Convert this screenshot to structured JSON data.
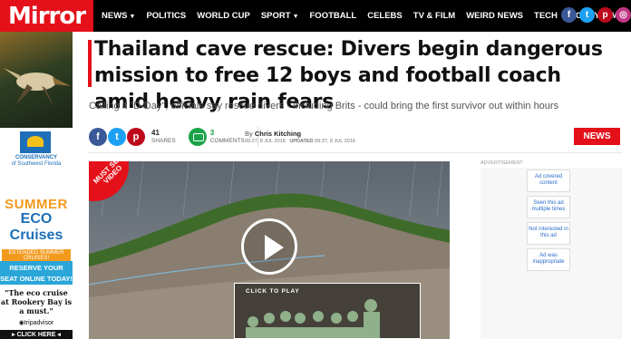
{
  "brand": {
    "name": "Mirror",
    "accent": "#e4101a"
  },
  "nav": {
    "items": [
      {
        "label": "NEWS",
        "dropdown": true
      },
      {
        "label": "POLITICS",
        "dropdown": false
      },
      {
        "label": "WORLD CUP",
        "dropdown": false
      },
      {
        "label": "SPORT",
        "dropdown": true
      },
      {
        "label": "FOOTBALL",
        "dropdown": false
      },
      {
        "label": "CELEBS",
        "dropdown": false
      },
      {
        "label": "TV & FILM",
        "dropdown": false
      },
      {
        "label": "WEIRD NEWS",
        "dropdown": false
      },
      {
        "label": "TECH",
        "dropdown": false
      },
      {
        "label": "MONEY",
        "dropdown": false
      },
      {
        "label": "MORE",
        "dropdown": true
      }
    ],
    "social": [
      {
        "icon": "facebook-icon",
        "glyph": "f",
        "color": "#3b5998"
      },
      {
        "icon": "twitter-icon",
        "glyph": "t",
        "color": "#1da1f2"
      },
      {
        "icon": "pinterest-icon",
        "glyph": "p",
        "color": "#bd081c"
      },
      {
        "icon": "instagram-icon",
        "glyph": "◎",
        "color": "#c13584"
      }
    ]
  },
  "left_ad": {
    "org": "CONSERVANCY",
    "org_sub": "of Southwest Florida",
    "summer": "SUMMER",
    "eco": "ECO Cruises",
    "extended": "EXTENDED SUMMER CRUISES!",
    "reserve": "RESERVE YOUR SEAT ONLINE TODAY!",
    "quote": "\"The eco cruise at Rookery Bay is a must.\"",
    "tripadvisor": "tripadvisor",
    "click": "▸ CLICK HERE ◂"
  },
  "article": {
    "headline": "Thailand cave rescue: Divers begin dangerous mission to free 12 boys and football coach amid heavy rain fears",
    "standfirst": "Calling it \"D-Day\", officials say rescue divers - including Brits - could bring the first survivor out within hours",
    "shares": {
      "count": "41",
      "label": "SHARES"
    },
    "comments": {
      "count": "3",
      "label": "COMMENTS"
    },
    "byline": {
      "prefix": "By",
      "author": "Chris Kitching",
      "published": "09:27, 8 JUL 2018",
      "updated_label": "UPDATED",
      "updated": "09:37, 8 JUL 2018"
    },
    "category": "NEWS"
  },
  "video": {
    "badge": "MUST SEE VIDEO",
    "click_to_play": "CLICK TO PLAY"
  },
  "right": {
    "ad_label": "ADVERTISEMENT",
    "feedback": [
      "Ad covered content",
      "Seen this ad multiple times",
      "Not interested in this ad",
      "Ad was inappropriate"
    ]
  }
}
